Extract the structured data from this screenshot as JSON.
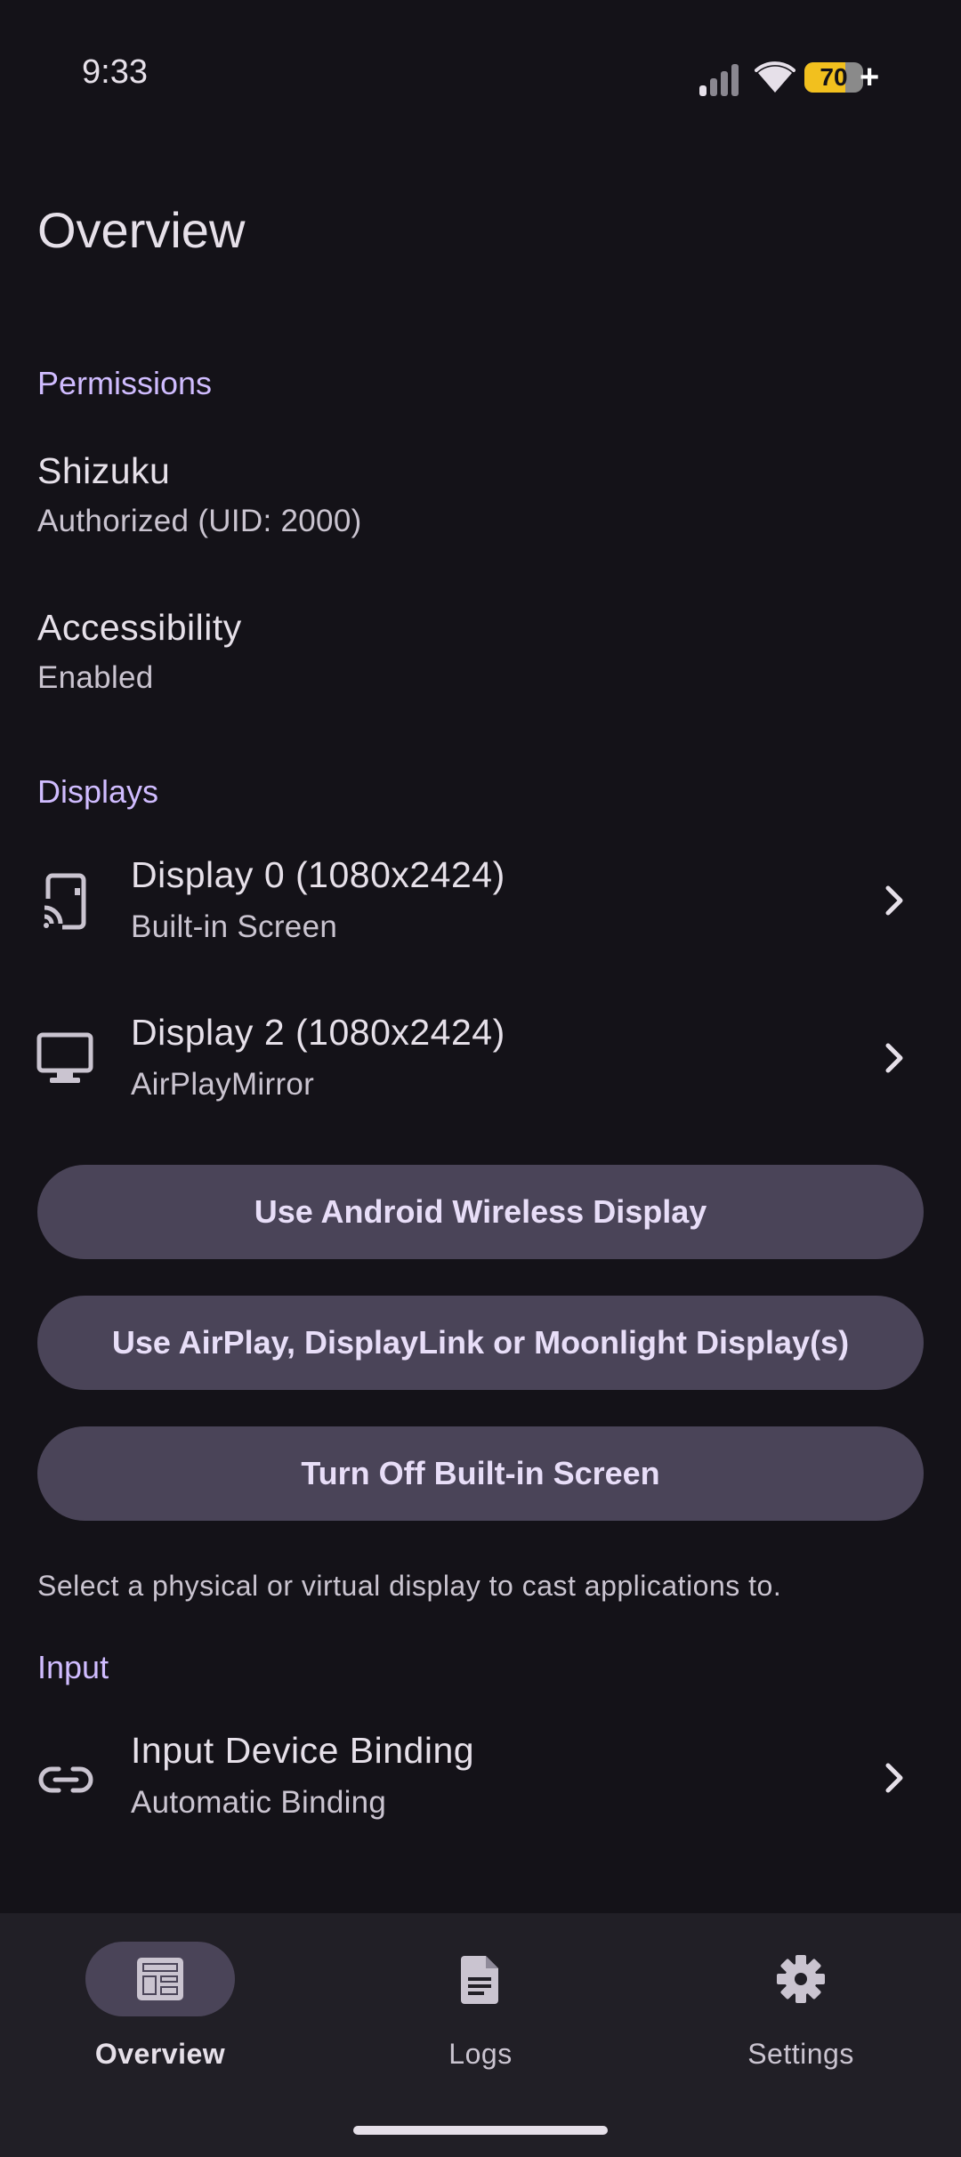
{
  "status_bar": {
    "time": "9:33",
    "battery": "70",
    "battery_level": 0.7,
    "icons": [
      "signal-icon",
      "wifi-icon",
      "battery-icon"
    ]
  },
  "page": {
    "title": "Overview"
  },
  "permissions": {
    "header": "Permissions",
    "items": [
      {
        "title": "Shizuku",
        "subtitle": "Authorized (UID: 2000)"
      },
      {
        "title": "Accessibility",
        "subtitle": "Enabled"
      }
    ]
  },
  "displays": {
    "header": "Displays",
    "items": [
      {
        "title": "Display 0 (1080x2424)",
        "subtitle": "Built-in Screen",
        "icon": "cast-phone-icon"
      },
      {
        "title": "Display 2 (1080x2424)",
        "subtitle": "AirPlayMirror",
        "icon": "monitor-icon"
      }
    ],
    "buttons": [
      "Use Android Wireless Display",
      "Use AirPlay, DisplayLink or Moonlight Display(s)",
      "Turn Off Built-in Screen"
    ],
    "hint": "Select a physical or virtual display to cast applications to."
  },
  "input": {
    "header": "Input",
    "items": [
      {
        "title": "Input Device Binding",
        "subtitle": "Automatic Binding",
        "icon": "link-icon"
      }
    ]
  },
  "bottom_nav": {
    "items": [
      {
        "label": "Overview",
        "icon": "dashboard-icon",
        "active": true
      },
      {
        "label": "Logs",
        "icon": "document-icon",
        "active": false
      },
      {
        "label": "Settings",
        "icon": "gear-icon",
        "active": false
      }
    ]
  },
  "colors": {
    "background": "#141218",
    "accent": "#D0BCFF",
    "button": "#4A4458",
    "nav_background": "#211F26",
    "battery": "#F2C01E"
  }
}
